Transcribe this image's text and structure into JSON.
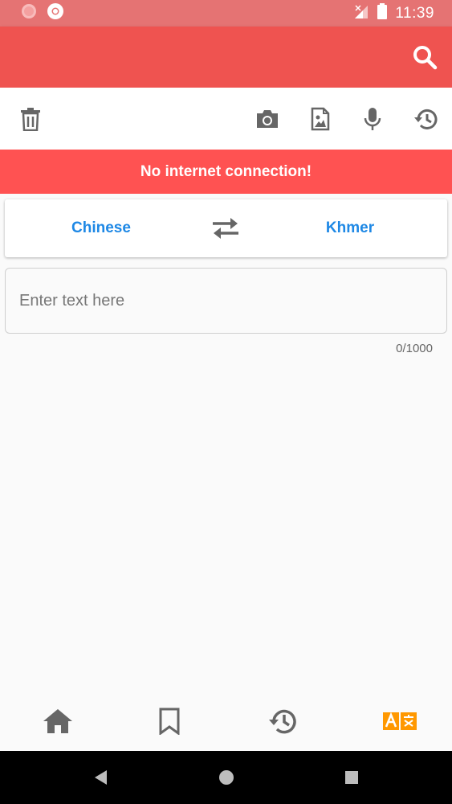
{
  "status_bar": {
    "time": "11:39"
  },
  "banner": {
    "message": "No internet connection!"
  },
  "languages": {
    "source": "Chinese",
    "target": "Khmer"
  },
  "input": {
    "placeholder": "Enter text here",
    "value": "",
    "counter": "0/1000"
  },
  "colors": {
    "status_bar": "#e57373",
    "app_bar": "#ef5350",
    "banner": "#ff5252",
    "language_text": "#1e88e5",
    "icon_gray": "#666666",
    "translate_active": "#ff9800"
  },
  "icons": {
    "app_bar": [
      "search-icon"
    ],
    "toolbar": [
      "trash-icon",
      "camera-icon",
      "image-file-icon",
      "microphone-icon",
      "history-icon"
    ],
    "bottom_nav": [
      "home-icon",
      "bookmark-icon",
      "history-icon",
      "translate-icon"
    ]
  }
}
